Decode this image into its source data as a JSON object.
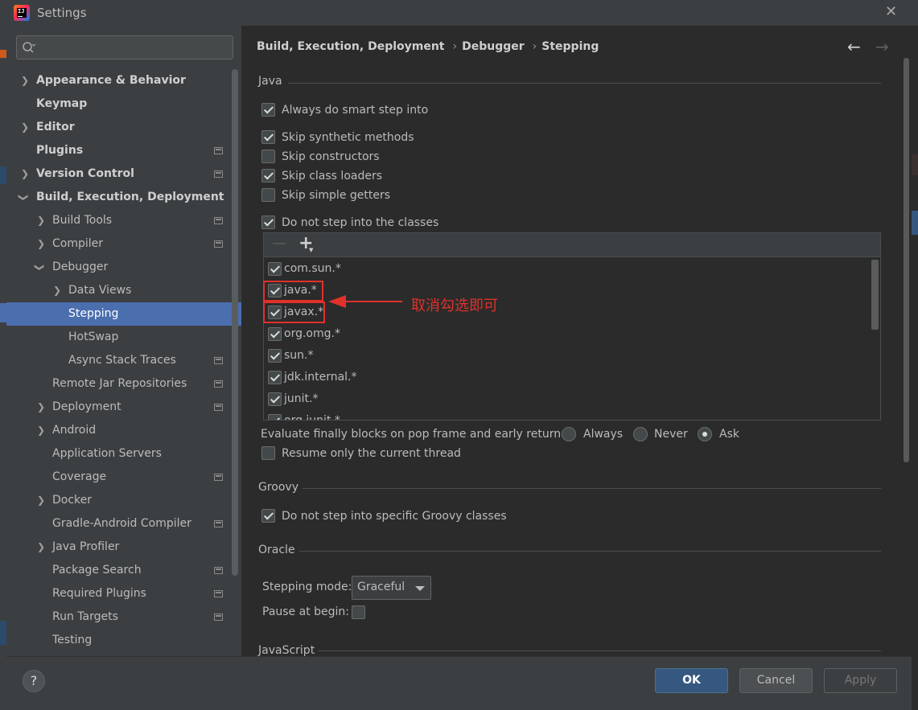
{
  "window": {
    "title": "Settings"
  },
  "sidebar": {
    "search_placeholder": "",
    "items": [
      {
        "label": "Appearance & Behavior"
      },
      {
        "label": "Keymap"
      },
      {
        "label": "Editor"
      },
      {
        "label": "Plugins"
      },
      {
        "label": "Version Control"
      },
      {
        "label": "Build, Execution, Deployment"
      },
      {
        "label": "Build Tools"
      },
      {
        "label": "Compiler"
      },
      {
        "label": "Debugger"
      },
      {
        "label": "Data Views"
      },
      {
        "label": "Stepping"
      },
      {
        "label": "HotSwap"
      },
      {
        "label": "Async Stack Traces"
      },
      {
        "label": "Remote Jar Repositories"
      },
      {
        "label": "Deployment"
      },
      {
        "label": "Android"
      },
      {
        "label": "Application Servers"
      },
      {
        "label": "Coverage"
      },
      {
        "label": "Docker"
      },
      {
        "label": "Gradle-Android Compiler"
      },
      {
        "label": "Java Profiler"
      },
      {
        "label": "Package Search"
      },
      {
        "label": "Required Plugins"
      },
      {
        "label": "Run Targets"
      },
      {
        "label": "Testing"
      }
    ]
  },
  "breadcrumb": [
    "Build, Execution, Deployment",
    "Debugger",
    "Stepping"
  ],
  "java": {
    "section": "Java",
    "always_smart_step": "Always do smart step into",
    "skip_synthetic": "Skip synthetic methods",
    "skip_constructors": "Skip constructors",
    "skip_class_loaders": "Skip class loaders",
    "skip_simple_getters": "Skip simple getters",
    "do_not_step_classes": "Do not step into the classes",
    "class_filters": [
      "com.sun.*",
      "java.*",
      "javax.*",
      "org.omg.*",
      "sun.*",
      "jdk.internal.*",
      "junit.*",
      "org.junit.*"
    ],
    "evaluate_finally_label": "Evaluate finally blocks on pop frame and early return:",
    "radio_always": "Always",
    "radio_never": "Never",
    "radio_ask": "Ask",
    "resume_current_thread": "Resume only the current thread"
  },
  "annotation": "取消勾选即可",
  "groovy": {
    "section": "Groovy",
    "do_not_step_groovy": "Do not step into specific Groovy classes"
  },
  "oracle": {
    "section": "Oracle",
    "stepping_mode_label": "Stepping mode:",
    "stepping_mode_value": "Graceful",
    "pause_at_begin_label": "Pause at begin:"
  },
  "javascript": {
    "section": "JavaScript"
  },
  "footer": {
    "help": "?",
    "ok": "OK",
    "cancel": "Cancel",
    "apply": "Apply"
  },
  "colors": {
    "accent": "#4b6eaf",
    "ok_button": "#365880",
    "annotation": "#e0312a"
  }
}
